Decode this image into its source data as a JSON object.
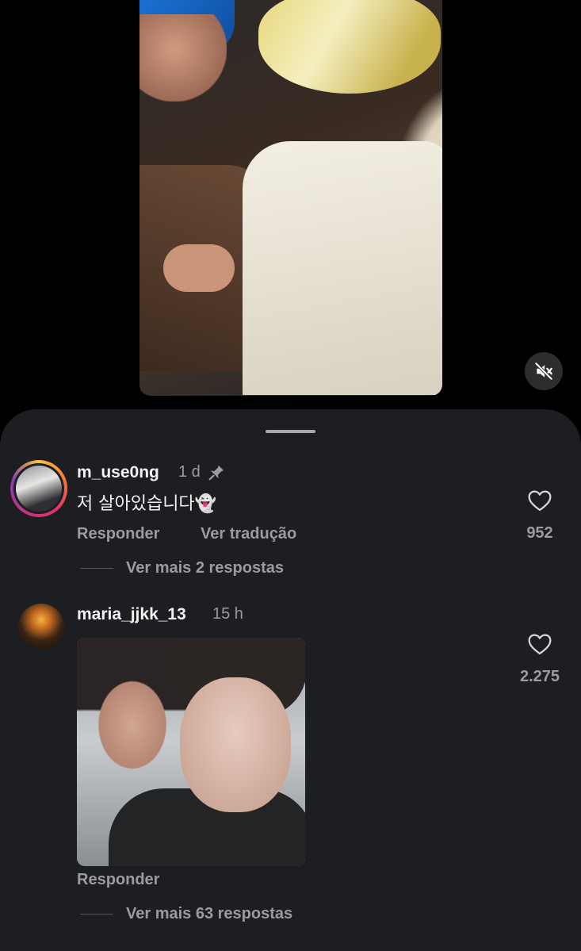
{
  "comments": [
    {
      "username": "m_use0ng",
      "time": "1 d",
      "pinned": true,
      "text": "저 살아있습니다👻",
      "reply_label": "Responder",
      "translate_label": "Ver tradução",
      "likes": "952",
      "more_replies": "Ver mais 2 respostas"
    },
    {
      "username": "maria_jjkk_13",
      "time": "15 h",
      "reply_label": "Responder",
      "likes": "2.275",
      "more_replies": "Ver mais 63 respostas"
    }
  ],
  "icons": {
    "mute": "speaker-muted-icon",
    "pin": "pin-icon",
    "like": "heart-outline-icon"
  },
  "colors": {
    "sheet_bg": "#1c1e21",
    "secondary_text": "#9a9ca0",
    "story_ring": [
      "#f9c33a",
      "#e1306c",
      "#833ab4"
    ]
  }
}
